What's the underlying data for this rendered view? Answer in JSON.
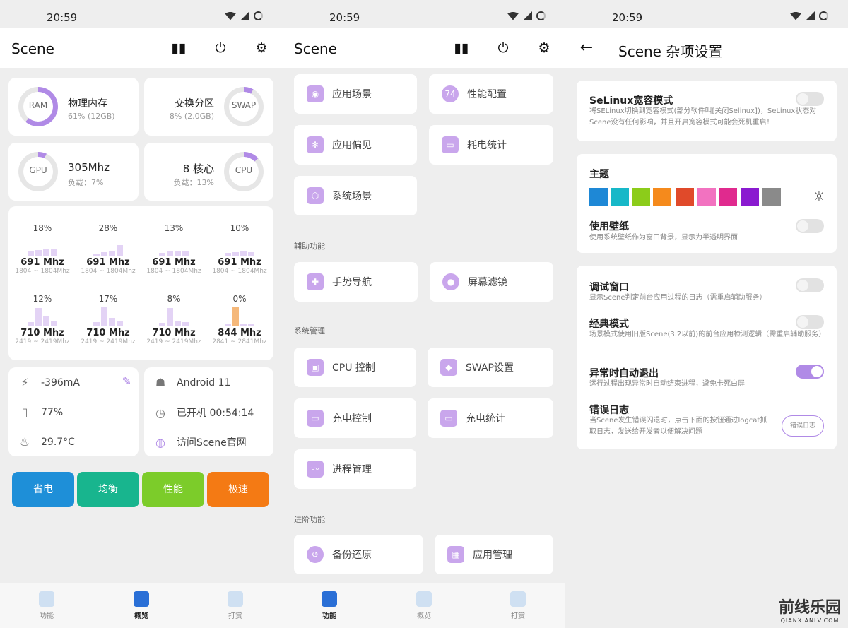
{
  "status": {
    "time": "20:59"
  },
  "overview": {
    "title": "Scene",
    "ram": {
      "gauge_label": "RAM",
      "title": "物理内存",
      "detail": "61% (12GB)",
      "percent": 61
    },
    "swap": {
      "gauge_label": "SWAP",
      "title": "交换分区",
      "detail": "8% (2.0GB)",
      "percent": 8
    },
    "gpu": {
      "gauge_label": "GPU",
      "freq": "305Mhz",
      "load": "负载：7%",
      "percent": 7
    },
    "cpu": {
      "gauge_label": "CPU",
      "cores": "8 核心",
      "load": "负载：13%",
      "percent": 13
    },
    "cores": [
      {
        "pct": "18%",
        "freq": "691 Mhz",
        "range": "1804 ~ 1804Mhz"
      },
      {
        "pct": "28%",
        "freq": "691 Mhz",
        "range": "1804 ~ 1804Mhz"
      },
      {
        "pct": "13%",
        "freq": "691 Mhz",
        "range": "1804 ~ 1804Mhz"
      },
      {
        "pct": "10%",
        "freq": "691 Mhz",
        "range": "1804 ~ 1804Mhz"
      },
      {
        "pct": "12%",
        "freq": "710 Mhz",
        "range": "2419 ~ 2419Mhz"
      },
      {
        "pct": "17%",
        "freq": "710 Mhz",
        "range": "2419 ~ 2419Mhz"
      },
      {
        "pct": "8%",
        "freq": "710 Mhz",
        "range": "2419 ~ 2419Mhz"
      },
      {
        "pct": "0%",
        "freq": "844 Mhz",
        "range": "2841 ~ 2841Mhz"
      }
    ],
    "battery": {
      "current": "-396mA",
      "level": "77%",
      "temp": "29.7°C"
    },
    "system": {
      "android": "Android 11",
      "uptime": "已开机  00:54:14",
      "website": "访问Scene官网"
    },
    "modes": [
      {
        "label": "省电",
        "color": "#1e8fd8"
      },
      {
        "label": "均衡",
        "color": "#18b58e"
      },
      {
        "label": "性能",
        "color": "#7ccc2a"
      },
      {
        "label": "极速",
        "color": "#f47a14"
      }
    ]
  },
  "functions": {
    "title": "Scene",
    "top": [
      "应用场景",
      "性能配置",
      "应用偏见",
      "耗电统计",
      "系统场景"
    ],
    "sections": {
      "assist": "辅助功能",
      "system": "系统管理",
      "advanced": "进阶功能"
    },
    "assist_items": [
      "手势导航",
      "屏幕滤镜"
    ],
    "system_items": [
      "CPU 控制",
      "SWAP设置",
      "充电控制",
      "充电统计",
      "进程管理"
    ],
    "advanced_items": [
      "备份还原",
      "应用管理"
    ]
  },
  "settings": {
    "title": "Scene 杂项设置",
    "selinux": {
      "title": "SeLinux宽容模式",
      "desc": "将SELinux切换到宽容模式(部分软件叫[关闭Selinux])，SeLinux状态对Scene没有任何影响，并且开启宽容模式可能会死机重启！"
    },
    "theme": {
      "title": "主题",
      "colors": [
        "#1e88d6",
        "#17b8c8",
        "#8ccc1a",
        "#f58a1c",
        "#e04a2a",
        "#f272c0",
        "#e02a8e",
        "#8a1ad0",
        "#8a8a8a"
      ]
    },
    "wallpaper": {
      "title": "使用壁纸",
      "desc": "使用系统壁纸作为窗口背景，显示为半透明界面"
    },
    "debug": {
      "title": "调试窗口",
      "desc": "显示Scene判定前台应用过程的日志（需重启辅助服务）"
    },
    "classic": {
      "title": "经典模式",
      "desc": "场景模式使用旧版Scene(3.2以前)的前台应用检测逻辑（需重启辅助服务）"
    },
    "autoexit": {
      "title": "异常时自动退出",
      "desc": "运行过程出现异常时自动结束进程，避免卡死白屏"
    },
    "errorlog": {
      "title": "错误日志",
      "desc": "当Scene发生错误闪退时，点击下面的按钮通过logcat抓取日志，发送给开发者以便解决问题",
      "button": "错误日志"
    }
  },
  "nav": {
    "functions": "功能",
    "overview": "概览",
    "reward": "打赏"
  },
  "watermark": {
    "title": "前线乐园",
    "sub": "QIANXIANLV.COM"
  }
}
